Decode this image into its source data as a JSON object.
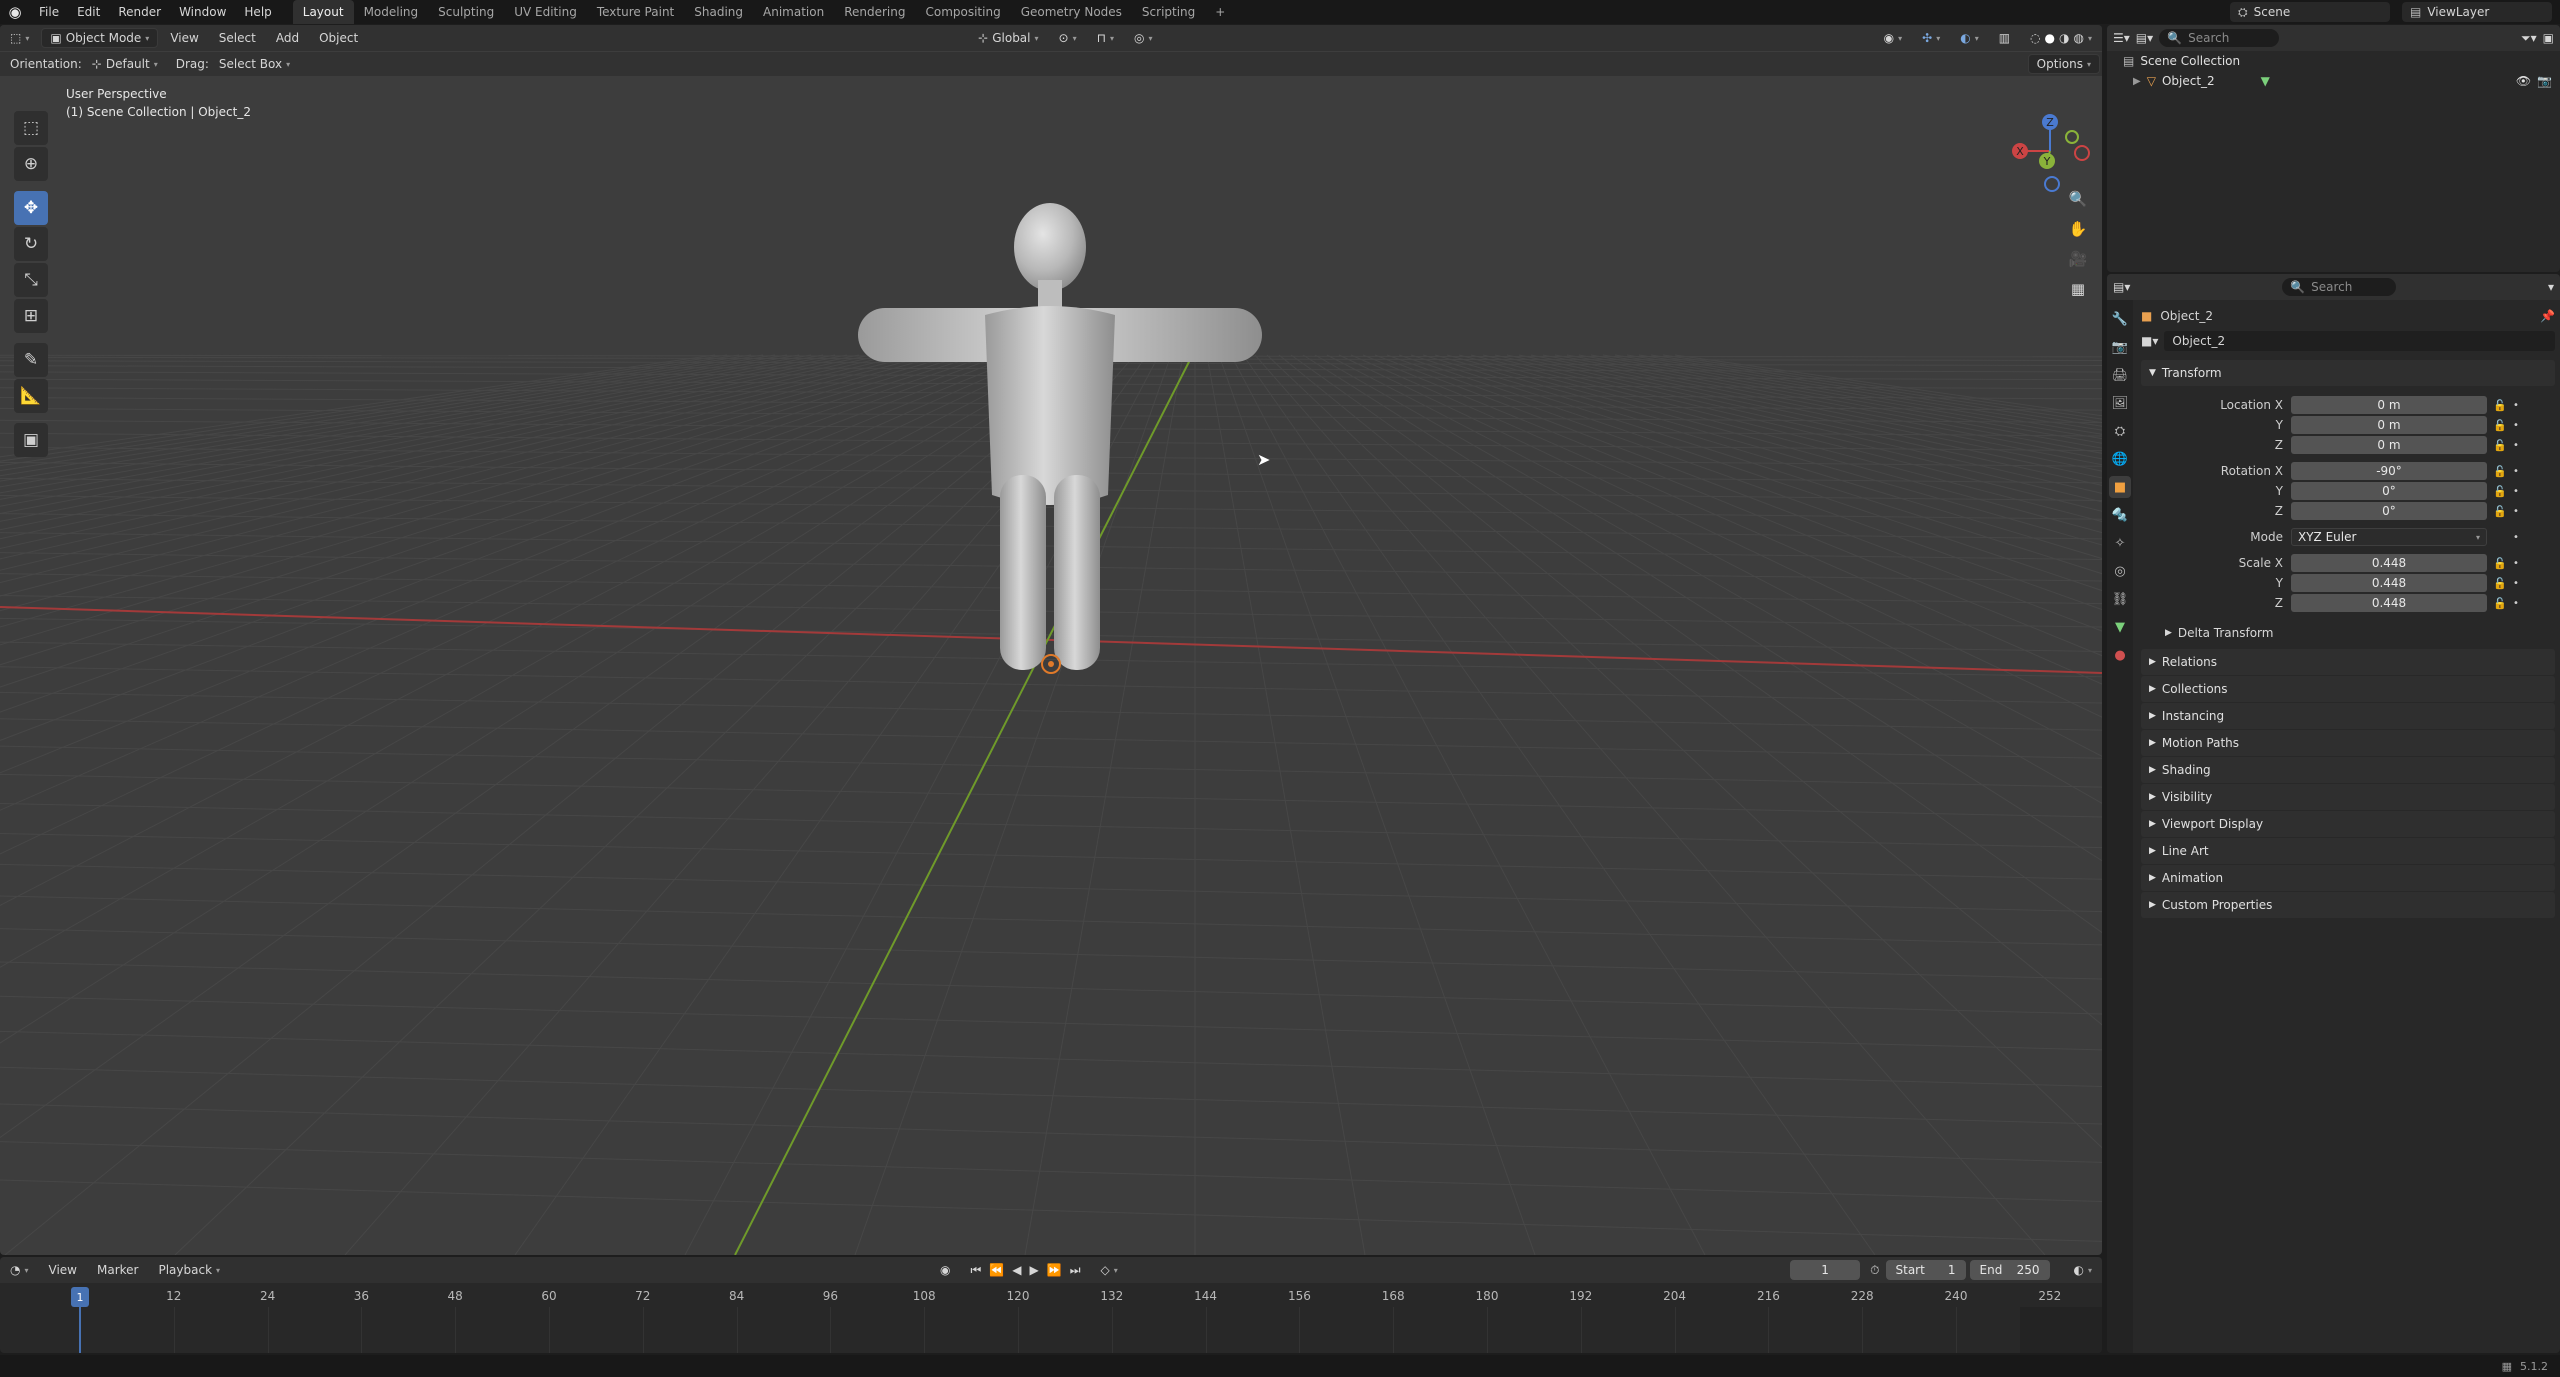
{
  "topbar": {
    "menus": [
      "File",
      "Edit",
      "Render",
      "Window",
      "Help"
    ],
    "workspaces": [
      "Layout",
      "Modeling",
      "Sculpting",
      "UV Editing",
      "Texture Paint",
      "Shading",
      "Animation",
      "Rendering",
      "Compositing",
      "Geometry Nodes",
      "Scripting"
    ],
    "active_workspace": "Layout",
    "scene": "Scene",
    "view_layer": "ViewLayer"
  },
  "viewport": {
    "mode": "Object Mode",
    "menus": [
      "View",
      "Select",
      "Add",
      "Object"
    ],
    "transform_orientation": "Global",
    "orientation_label": "Orientation:",
    "orientation_value": "Default",
    "drag_label": "Drag:",
    "drag_value": "Select Box",
    "options_label": "Options",
    "view_name": "User Perspective",
    "collection_info": "(1) Scene Collection | Object_2",
    "gizmo": {
      "x": "X",
      "y": "Y",
      "z": "Z"
    }
  },
  "timeline": {
    "menus": [
      "View",
      "Marker",
      "Playback"
    ],
    "current_frame": "1",
    "start_label": "Start",
    "start": "1",
    "end_label": "End",
    "end": "250",
    "ticks": [
      "1",
      "12",
      "24",
      "36",
      "48",
      "60",
      "72",
      "84",
      "96",
      "108",
      "120",
      "132",
      "144",
      "156",
      "168",
      "180",
      "192",
      "204",
      "216",
      "228",
      "240",
      "252"
    ]
  },
  "outliner": {
    "search_placeholder": "Search",
    "root": "Scene Collection",
    "object": "Object_2"
  },
  "properties": {
    "search_placeholder": "Search",
    "context_object": "Object_2",
    "object_name": "Object_2",
    "transform": {
      "title": "Transform",
      "location_label": "Location X",
      "location": [
        "0 m",
        "0 m",
        "0 m"
      ],
      "rotation_label": "Rotation X",
      "rotation": [
        "-90°",
        "0°",
        "0°"
      ],
      "mode_label": "Mode",
      "mode": "XYZ Euler",
      "scale_label": "Scale X",
      "scale": [
        "0.448",
        "0.448",
        "0.448"
      ],
      "y_label": "Y",
      "z_label": "Z",
      "delta": "Delta Transform"
    },
    "panels": [
      "Relations",
      "Collections",
      "Instancing",
      "Motion Paths",
      "Shading",
      "Visibility",
      "Viewport Display",
      "Line Art",
      "Animation",
      "Custom Properties"
    ]
  },
  "statusbar": {
    "version": "5.1.2"
  }
}
